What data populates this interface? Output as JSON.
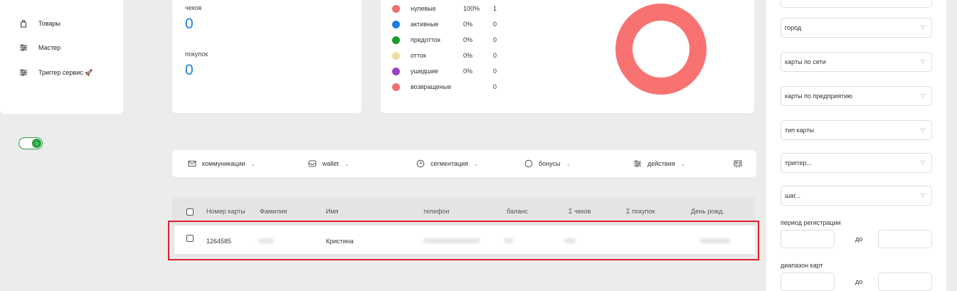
{
  "nav": {
    "items": [
      {
        "label": "Товары",
        "icon": "bag-icon"
      },
      {
        "label": "Мастер",
        "icon": "sliders-icon"
      },
      {
        "label": "Триггер сервис 🚀",
        "icon": "sliders-icon"
      }
    ]
  },
  "theme_toggle": {
    "icon": "sun-icon",
    "state": "on"
  },
  "stats": {
    "checks_label": "чеков",
    "checks_value": "0",
    "purchases_label": "покупок",
    "purchases_value": "0"
  },
  "segments": [
    {
      "name": "нулевые",
      "pct": "100%",
      "count": "1",
      "color": "#f07070"
    },
    {
      "name": "активные",
      "pct": "0%",
      "count": "0",
      "color": "#1a7fe0"
    },
    {
      "name": "предотток",
      "pct": "0%",
      "count": "0",
      "color": "#1a9b2a"
    },
    {
      "name": "отток",
      "pct": "0%",
      "count": "0",
      "color": "#f3dca8"
    },
    {
      "name": "ушедшие",
      "pct": "0%",
      "count": "0",
      "color": "#9b40c8"
    },
    {
      "name": "возвращеные",
      "pct": "",
      "count": "0",
      "color": "#f07070"
    }
  ],
  "donut": {
    "color": "#f87272",
    "share_of_first_segment": 1.0
  },
  "filters": {
    "selects": [
      "город",
      "карты по сети",
      "карты по предприятию",
      "тип карты",
      "триггер...",
      "шаг..."
    ],
    "registration_label": "период регистрации",
    "range_label": "диапазон карт",
    "to_label": "до"
  },
  "toolbar": {
    "items": [
      {
        "label": "коммуникации",
        "icon": "mail-icon"
      },
      {
        "label": "wallet",
        "icon": "wallet-icon"
      },
      {
        "label": "сегментация",
        "icon": "clock-icon"
      },
      {
        "label": "бонусы",
        "icon": "circle-icon"
      },
      {
        "label": "действия",
        "icon": "sliders-icon"
      }
    ],
    "export_icon": "id-card-icon"
  },
  "table": {
    "columns": [
      "Номер карты",
      "Фамилия",
      "Имя",
      "телефон",
      "баланс",
      "Σ чеков",
      "Σ покупок",
      "День рожд."
    ],
    "rows": [
      {
        "card": "1264585",
        "first_name": "Кристина"
      }
    ]
  },
  "colors": {
    "accent": "#1a7fe0",
    "toggle": "#22a03a",
    "highlight": "#e0202a"
  }
}
